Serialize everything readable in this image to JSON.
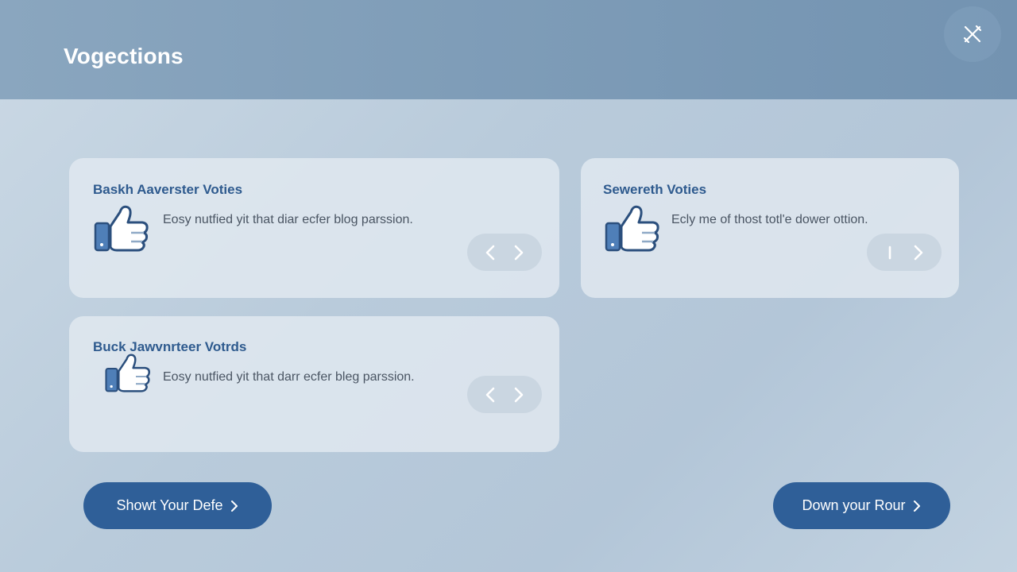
{
  "header": {
    "title": "Vogections",
    "close_icon": "close-icon"
  },
  "cards": [
    {
      "title": "Baskh Aaverster Voties",
      "description": "Eosy nutfied yit that diar ecfer blog parssion.",
      "icon": "thumbs-up-icon",
      "pager": {
        "prev_icon": "chevron-left-icon",
        "next_icon": "chevron-right-icon"
      }
    },
    {
      "title": "Sewereth Voties",
      "description": "Ecly me of thost totl'e dower ottion.",
      "icon": "thumbs-up-icon",
      "pager": {
        "prev_icon": "cursor-bar-icon",
        "next_icon": "chevron-right-icon"
      }
    },
    {
      "title": "Buck Jawvnrteer Votrds",
      "description": "Eosy nutfied yit that darr ecfer bleg parssion.",
      "icon": "thumbs-up-icon",
      "pager": {
        "prev_icon": "chevron-left-icon",
        "next_icon": "chevron-right-icon"
      }
    }
  ],
  "actions": {
    "left_label": "Showt Your Defe",
    "right_label": "Down your Rour"
  },
  "colors": {
    "accent": "#2f5f98",
    "title_text": "#2e5a8e",
    "header": "#7f9db8"
  }
}
